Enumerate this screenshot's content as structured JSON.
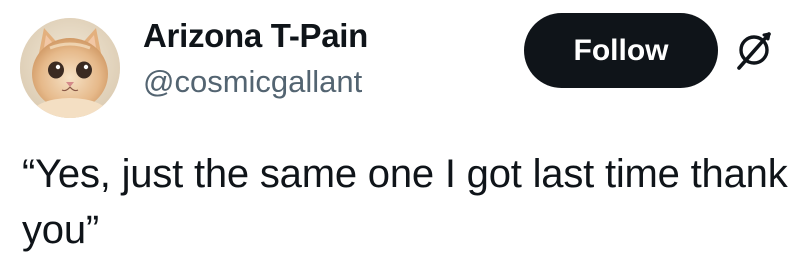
{
  "author": {
    "display_name": "Arizona T-Pain",
    "handle": "@cosmicgallant",
    "avatar": "kitten-photo"
  },
  "actions": {
    "follow_label": "Follow",
    "platform_icon": "x-logo-icon"
  },
  "tweet": {
    "text": "“Yes, just the same one I got last time thank you”"
  },
  "colors": {
    "button_bg": "#0f1419",
    "button_text": "#ffffff",
    "handle_text": "#536471",
    "body_text": "#0f1419"
  }
}
